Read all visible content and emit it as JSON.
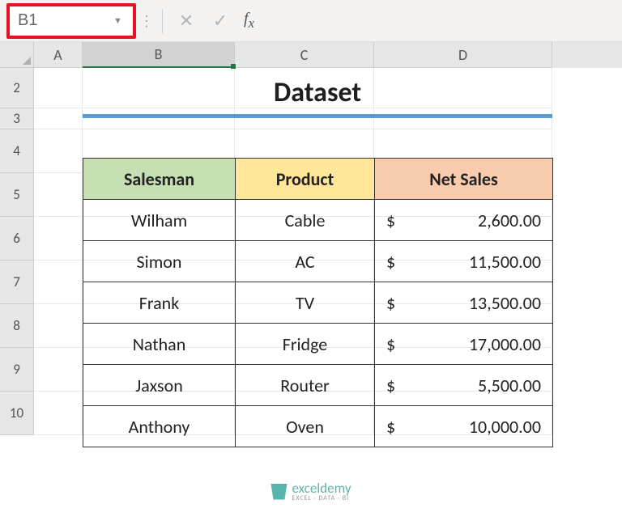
{
  "nameBox": "B1",
  "formulaValue": "",
  "columns": [
    "A",
    "B",
    "C",
    "D"
  ],
  "rowNumbers": [
    2,
    3,
    4,
    5,
    6,
    7,
    8,
    9,
    10
  ],
  "title": "Dataset",
  "headers": {
    "salesman": "Salesman",
    "product": "Product",
    "netsales": "Net Sales"
  },
  "currency": "$",
  "rows": [
    {
      "salesman": "Wilham",
      "product": "Cable",
      "netsales": "2,600.00"
    },
    {
      "salesman": "Simon",
      "product": "AC",
      "netsales": "11,500.00"
    },
    {
      "salesman": "Frank",
      "product": "TV",
      "netsales": "13,500.00"
    },
    {
      "salesman": "Nathan",
      "product": "Fridge",
      "netsales": "17,000.00"
    },
    {
      "salesman": "Jaxson",
      "product": "Router",
      "netsales": "5,500.00"
    },
    {
      "salesman": "Anthony",
      "product": "Oven",
      "netsales": "10,000.00"
    }
  ],
  "watermark": {
    "brand": "exceldemy",
    "sub": "EXCEL · DATA · BI"
  }
}
